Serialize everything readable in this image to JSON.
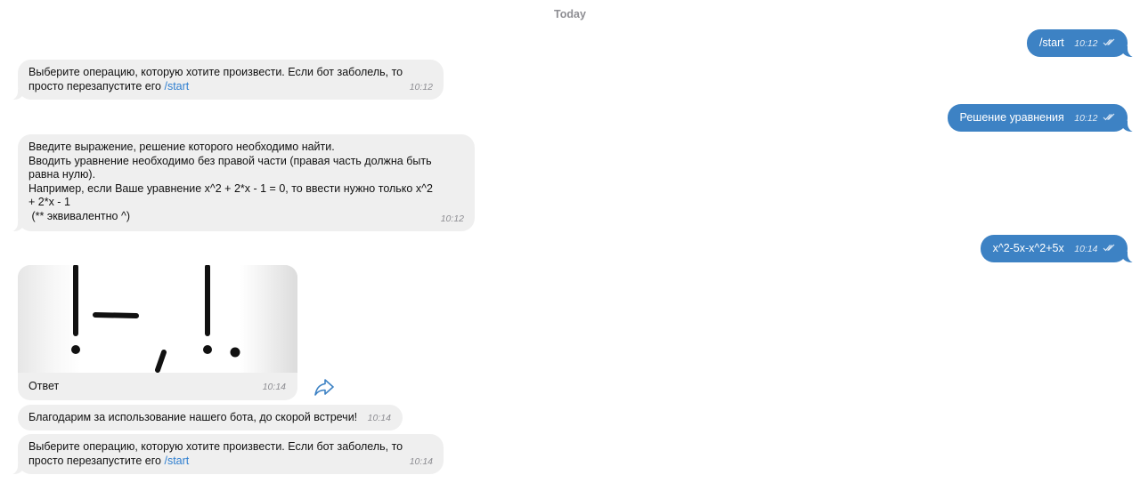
{
  "date_separator": "Today",
  "messages": {
    "out_start": {
      "text": "/start",
      "time": "10:12"
    },
    "in_menu_1": {
      "text": "Выберите операцию, которую хотите произвести. Если бот заболель, то",
      "text_line2": "просто перезапустите его",
      "link": "/start",
      "time": "10:12"
    },
    "out_solve": {
      "text": "Решение уравнения",
      "time": "10:12"
    },
    "in_instructions": {
      "lines": [
        "Введите выражение, решение которого необходимо найти.",
        "Вводить уравнение необходимо без правой части (правая часть должна быть",
        "равна нулю).",
        "Например, если Ваше уравнение x^2 + 2*x - 1 = 0, то ввести нужно только x^2",
        "+ 2*x - 1",
        " (** эквивалентно ^)"
      ],
      "time": "10:12"
    },
    "out_expr": {
      "text": "x^2-5x-x^2+5x",
      "time": "10:14"
    },
    "in_photo": {
      "caption": "Ответ",
      "time": "10:14"
    },
    "in_thanks": {
      "text": "Благодарим за использование нашего бота, до скорой встречи!",
      "time": "10:14"
    },
    "in_menu_2": {
      "text": "Выберите операцию, которую хотите произвести. Если бот заболель, то",
      "text_line2": "просто перезапустите его",
      "link": "/start",
      "time": "10:14"
    }
  },
  "icons": {
    "share": "share-arrow-icon",
    "read_receipt": "double-check-icon"
  },
  "colors": {
    "outgoing_bubble": "#3d82c4",
    "incoming_bubble": "#efefef",
    "link": "#2f7fd0"
  }
}
